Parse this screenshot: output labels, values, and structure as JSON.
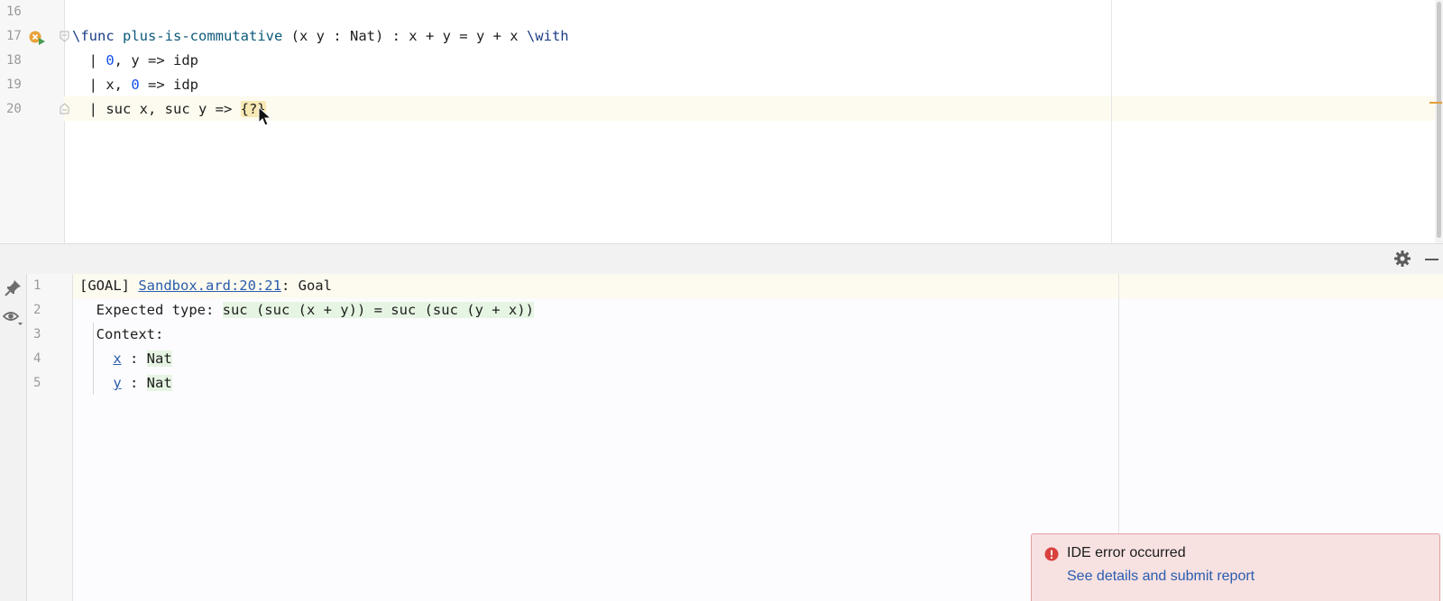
{
  "editor": {
    "lines": [
      {
        "number": "16"
      },
      {
        "number": "17",
        "kw_func": "\\func",
        "name": "plus-is-commutative",
        "signature": " (x y : Nat) : x + y = y + x ",
        "kw_with": "\\with"
      },
      {
        "number": "18",
        "bar": "  | ",
        "pat_zero": "0",
        "rest": ", y => idp"
      },
      {
        "number": "19",
        "bar": "  | x, ",
        "pat_zero": "0",
        "rest": " => idp"
      },
      {
        "number": "20",
        "prefix": "  | suc x, suc y => ",
        "hole": "{?}"
      }
    ]
  },
  "panel": {
    "lines": [
      {
        "number": "1",
        "tag": "[GOAL] ",
        "link": "Sandbox.ard:20:21",
        "suffix": ": Goal"
      },
      {
        "number": "2",
        "label": "  Expected type: ",
        "type": "suc (suc (x + y)) = suc (suc (y + x))"
      },
      {
        "number": "3",
        "label": "  Context:"
      },
      {
        "number": "4",
        "indent": "    ",
        "var": "x",
        "sep": " : ",
        "type": "Nat"
      },
      {
        "number": "5",
        "indent": "    ",
        "var": "y",
        "sep": " : ",
        "type": "Nat"
      }
    ]
  },
  "notification": {
    "title": "IDE error occurred",
    "action": "See details and submit report"
  },
  "icons": {
    "run": "run-with-error-icon",
    "settings": "gear-icon",
    "minimize": "minimize-icon",
    "pin": "pin-icon",
    "view": "eye-icon",
    "error": "error-icon"
  },
  "colors": {
    "keyword": "#1a3d86",
    "number": "#1750eb",
    "link": "#2a5cae",
    "hole_bg": "#f7e9b4",
    "type_bg": "#e6f5e3",
    "notif_bg": "#f7e1e1",
    "error": "#d9413e"
  }
}
